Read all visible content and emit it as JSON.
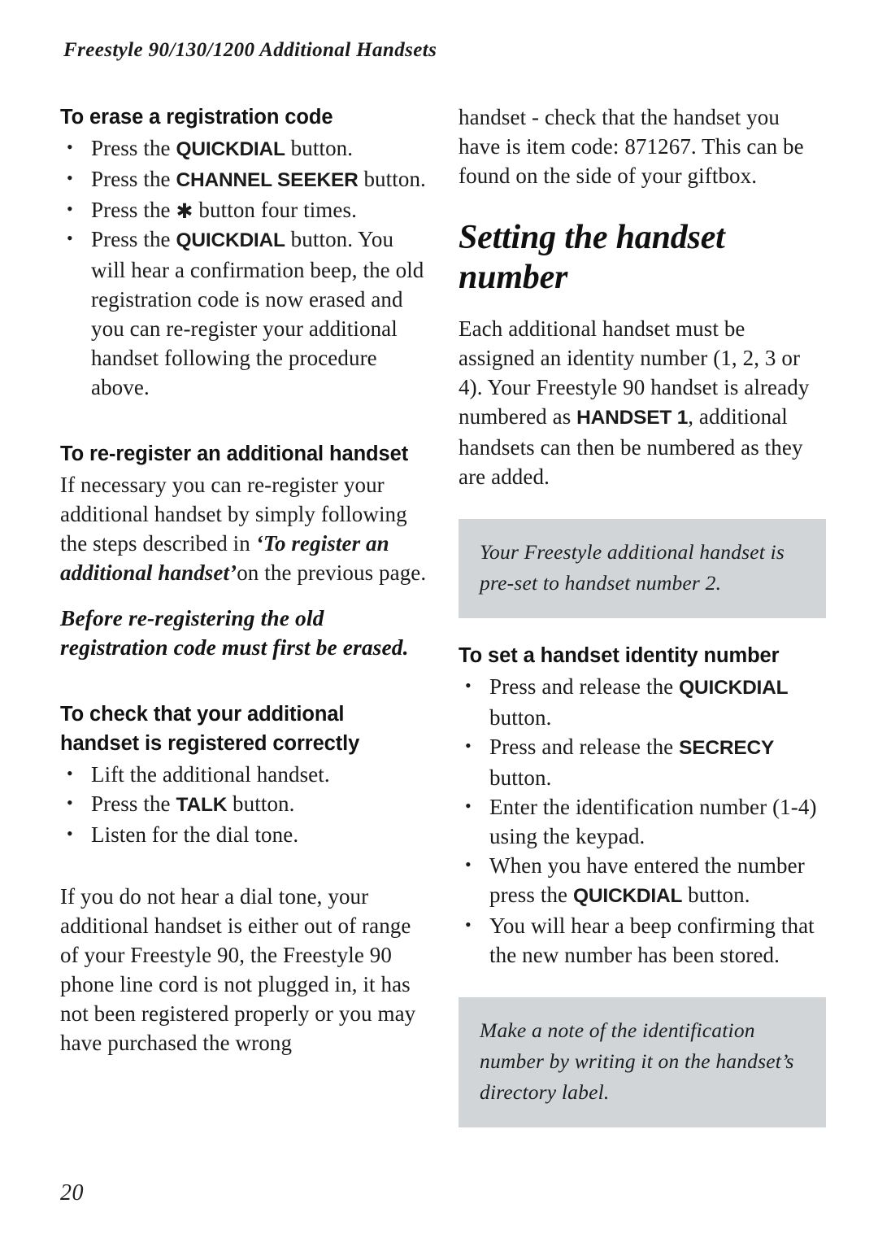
{
  "header": {
    "running_title": "Freestyle 90/130/1200 Additional Handsets"
  },
  "page_number": "20",
  "left_column": {
    "heading_1": "To erase a registration code",
    "bullets_1": [
      {
        "pre": "Press the ",
        "key": "QUICKDIAL",
        "post": " button."
      },
      {
        "pre": "Press the ",
        "key": "CHANNEL SEEKER",
        "post": " button."
      },
      {
        "pre": "Press the ",
        "symbol": "✱",
        "post": " button four times."
      },
      {
        "pre": "Press the ",
        "key": "QUICKDIAL",
        "post": " button. You will hear a confirmation beep, the old registration code is now erased and you can re-register your additional handset following the procedure above."
      }
    ],
    "heading_2": "To re-register an additional handset",
    "paragraph_1_pre": "If necessary you can re-register your additional handset by simply following the steps described in ",
    "paragraph_1_ref": "‘To register an additional handset’",
    "paragraph_1_post": "on the previous page.",
    "emphasis_1": "Before re-registering the old registration code must first be erased.",
    "heading_3": "To check that your additional handset is registered correctly",
    "bullets_2": [
      {
        "pre": "Lift the additional handset."
      },
      {
        "pre": "Press the ",
        "key": "TALK",
        "post": " button."
      },
      {
        "pre": "Listen for the dial tone."
      }
    ],
    "paragraph_2": "If you do not hear a dial tone, your additional handset is either out of range of your Freestyle 90, the Freestyle 90 phone line cord is not plugged in, it has not been registered properly or you may have purchased the wrong"
  },
  "right_column": {
    "paragraph_continued": "handset - check that the handset you have is item code: 871267. This can be found on the side of your giftbox.",
    "section_title": "Setting the handset number",
    "paragraph_1_pre": "Each additional handset must be assigned an identity number (1, 2, 3 or 4). Your Freestyle 90 handset is already numbered as ",
    "paragraph_1_key": "HANDSET 1",
    "paragraph_1_post": ", additional handsets can then be numbered as they are added.",
    "note_1": "Your Freestyle additional handset is pre-set to handset number 2.",
    "heading_1": "To set a handset identity number",
    "bullets_1": [
      {
        "pre": "Press and release the ",
        "key": "QUICKDIAL",
        "post": " button."
      },
      {
        "pre": "Press and release the ",
        "key": "SECRECY",
        "post": " button."
      },
      {
        "pre": "Enter the identification number (1-4) using the keypad."
      },
      {
        "pre": "When you have entered the number press the ",
        "key": "QUICKDIAL",
        "post": " button."
      },
      {
        "pre": "You will hear a beep confirming that the new number has been stored."
      }
    ],
    "note_2": "Make a note of the identification number by writing it on the handset’s directory label."
  },
  "colors": {
    "page_background": "#ffffff",
    "text": "#1b1b1b",
    "note_background": "#d2d5d7"
  }
}
